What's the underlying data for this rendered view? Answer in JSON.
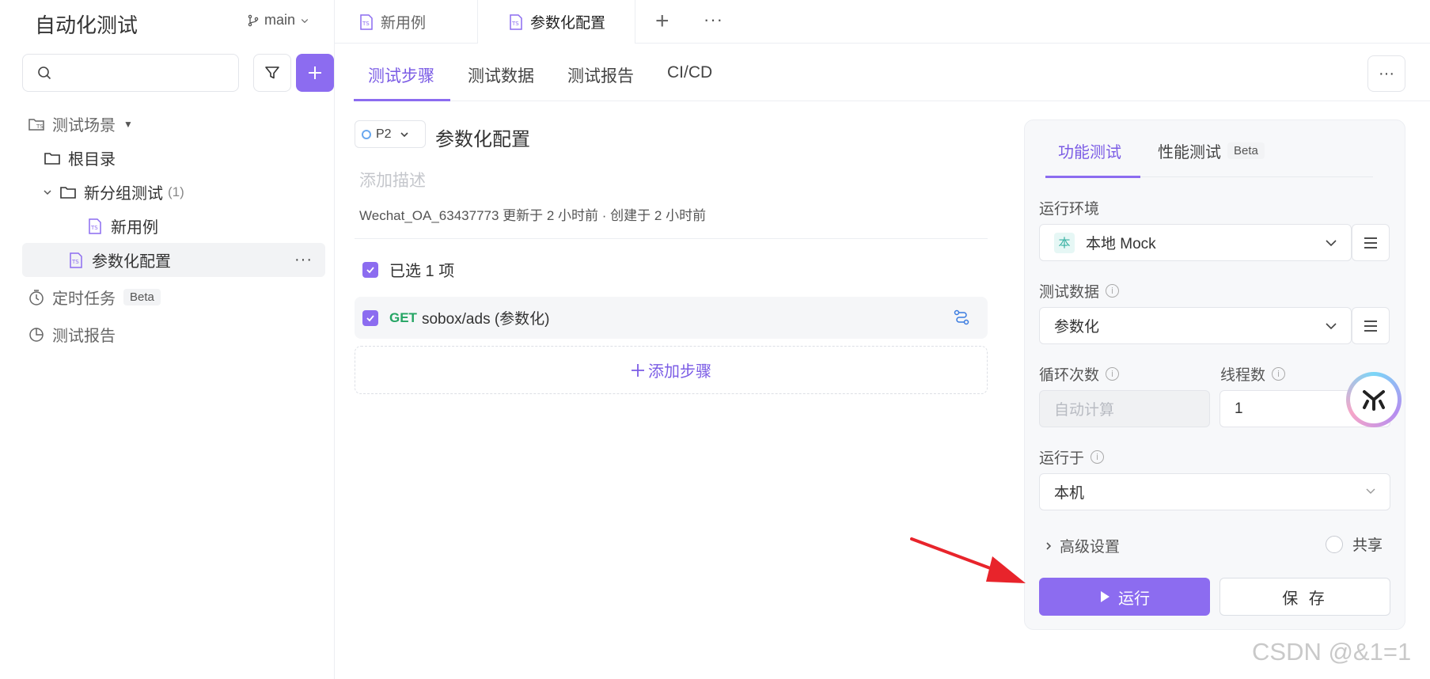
{
  "sidebar": {
    "title": "自动化测试",
    "branch": "main",
    "search_placeholder": "",
    "tree": {
      "scenes": "测试场景",
      "root": "根目录",
      "group": "新分组测试",
      "group_count": "(1)",
      "new_case": "新用例",
      "param_case": "参数化配置",
      "scheduled": "定时任务",
      "scheduled_badge": "Beta",
      "reports": "测试报告"
    }
  },
  "file_tabs": [
    {
      "label": "新用例"
    },
    {
      "label": "参数化配置"
    }
  ],
  "sub_tabs": [
    {
      "label": "测试步骤"
    },
    {
      "label": "测试数据"
    },
    {
      "label": "测试报告"
    },
    {
      "label": "CI/CD"
    }
  ],
  "case": {
    "priority": "P2",
    "title": "参数化配置",
    "description_placeholder": "添加描述",
    "meta": "Wechat_OA_63437773 更新于 2 小时前 · 创建于 2 小时前",
    "selected_text": "已选 1 项",
    "step": {
      "method": "GET",
      "path": "sobox/ads (参数化)"
    },
    "add_step": "添加步骤"
  },
  "panel": {
    "tabs": [
      {
        "label": "功能测试"
      },
      {
        "label": "性能测试",
        "badge": "Beta"
      }
    ],
    "env_label": "运行环境",
    "env_badge": "本",
    "env_value": "本地 Mock",
    "data_label": "测试数据",
    "data_value": "参数化",
    "loop_label": "循环次数",
    "loop_placeholder": "自动计算",
    "threads_label": "线程数",
    "threads_value": "1",
    "run_on_label": "运行于",
    "run_on_value": "本机",
    "advanced": "高级设置",
    "share": "共享",
    "run_button": "运行",
    "save_button": "保 存"
  },
  "colors": {
    "accent": "#8c6cf0",
    "get_method": "#25a564",
    "arrow": "#e8242b"
  },
  "watermark": "CSDN @&1=1"
}
